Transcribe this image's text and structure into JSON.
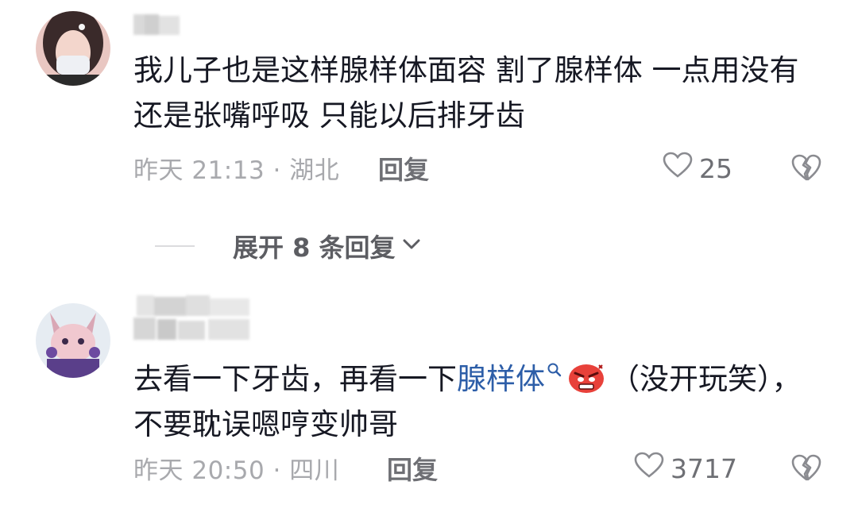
{
  "comments": [
    {
      "text": "我儿子也是这样腺样体面容 割了腺样体 一点用没有 还是张嘴呼吸 只能以后排牙齿",
      "meta": "昨天 21:13 · 湖北",
      "reply_label": "回复",
      "likes": "25"
    },
    {
      "text_before": "去看一下牙齿，再看一下",
      "highlight": "腺样体",
      "text_after": "（没开玩笑），不要耽误嗯哼变帅哥",
      "meta": "昨天 20:50 · 四川",
      "reply_label": "回复",
      "likes": "3717"
    }
  ],
  "expand_label": "展开 8 条回复",
  "icons": {
    "like": "heart-outline-icon",
    "dislike": "broken-heart-icon",
    "expand": "chevron-down-icon",
    "search": "search-icon",
    "emoji": "angry-face-emoji"
  },
  "colors": {
    "highlight": "#2d5ea8",
    "meta": "#a8a9ad",
    "emoji": "#e8413a"
  }
}
